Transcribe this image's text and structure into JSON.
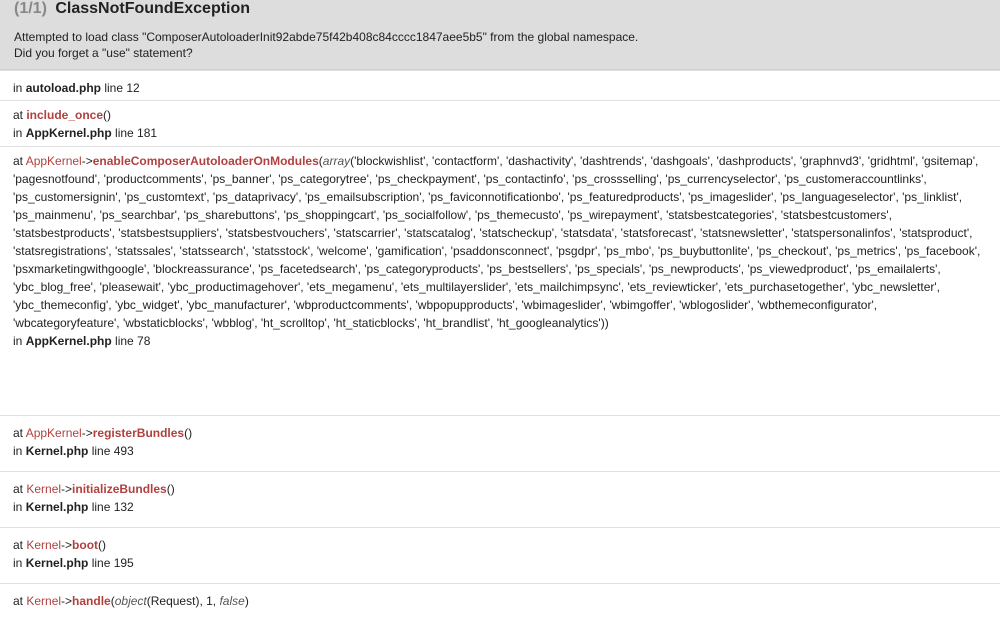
{
  "header": {
    "count": "(1/1)",
    "exception_name": "ClassNotFoundException",
    "message_line1": "Attempted to load class \"ComposerAutoloaderInit92abde75f42b408c84cccc1847aee5b5\" from the global namespace.",
    "message_line2": "Did you forget a \"use\" statement?"
  },
  "frames": [
    {
      "loc_prefix": "in ",
      "file": "autoload.php",
      "line": " line 12"
    },
    {
      "at": "at ",
      "function": "include_once",
      "args": "()",
      "loc_prefix": "in ",
      "file": "AppKernel.php",
      "line": " line 181"
    },
    {
      "at": "at ",
      "class": "AppKernel",
      "arrow": "->",
      "function": "enableComposerAutoloaderOnModules",
      "open": "(",
      "array_kw": "array",
      "args_text": "('blockwishlist', 'contactform', 'dashactivity', 'dashtrends', 'dashgoals', 'dashproducts', 'graphnvd3', 'gridhtml', 'gsitemap', 'pagesnotfound', 'productcomments', 'ps_banner', 'ps_categorytree', 'ps_checkpayment', 'ps_contactinfo', 'ps_crossselling', 'ps_currencyselector', 'ps_customeraccountlinks', 'ps_customersignin', 'ps_customtext', 'ps_dataprivacy', 'ps_emailsubscription', 'ps_faviconnotificationbo', 'ps_featuredproducts', 'ps_imageslider', 'ps_languageselector', 'ps_linklist', 'ps_mainmenu', 'ps_searchbar', 'ps_sharebuttons', 'ps_shoppingcart', 'ps_socialfollow', 'ps_themecusto', 'ps_wirepayment', 'statsbestcategories', 'statsbestcustomers', 'statsbestproducts', 'statsbestsuppliers', 'statsbestvouchers', 'statscarrier', 'statscatalog', 'statscheckup', 'statsdata', 'statsforecast', 'statsnewsletter', 'statspersonalinfos', 'statsproduct', 'statsregistrations', 'statssales', 'statssearch', 'statsstock', 'welcome', 'gamification', 'psaddonsconnect', 'psgdpr', 'ps_mbo', 'ps_buybuttonlite', 'ps_checkout', 'ps_metrics', 'ps_facebook', 'psxmarketingwithgoogle', 'blockreassurance', 'ps_facetedsearch', 'ps_categoryproducts', 'ps_bestsellers', 'ps_specials', 'ps_newproducts', 'ps_viewedproduct', 'ps_emailalerts', 'ybc_blog_free', 'pleasewait', 'ybc_productimagehover', 'ets_megamenu', 'ets_multilayerslider', 'ets_mailchimpsync', 'ets_reviewticker', 'ets_purchasetogether', 'ybc_newsletter', 'ybc_themeconfig', 'ybc_widget', 'ybc_manufacturer', 'wbproductcomments', 'wbpopupproducts', 'wbimageslider', 'wbimgoffer', 'wblogoslider', 'wbthemeconfigurator', 'wbcategoryfeature', 'wbstaticblocks', 'wbblog', 'ht_scrolltop', 'ht_staticblocks', 'ht_brandlist', 'ht_googleanalytics'))",
      "loc_prefix": "in ",
      "file": "AppKernel.php",
      "line": " line 78"
    },
    {
      "at": "at ",
      "class": "AppKernel",
      "arrow": "->",
      "function": "registerBundles",
      "args": "()",
      "loc_prefix": "in ",
      "file": "Kernel.php",
      "line": " line 493"
    },
    {
      "at": "at ",
      "class": "Kernel",
      "arrow": "->",
      "function": "initializeBundles",
      "args": "()",
      "loc_prefix": "in ",
      "file": "Kernel.php",
      "line": " line 132"
    },
    {
      "at": "at ",
      "class": "Kernel",
      "arrow": "->",
      "function": "boot",
      "args": "()",
      "loc_prefix": "in ",
      "file": "Kernel.php",
      "line": " line 195"
    },
    {
      "at": "at ",
      "class": "Kernel",
      "arrow": "->",
      "function": "handle",
      "open": "(",
      "arg1": "object",
      "arg1_rest": "(Request), 1, ",
      "arg2": "false",
      "close": ")"
    }
  ],
  "colors": {
    "header_bg": "#dddddd",
    "class_fn": "#b0413e",
    "count_gray": "#888888"
  }
}
